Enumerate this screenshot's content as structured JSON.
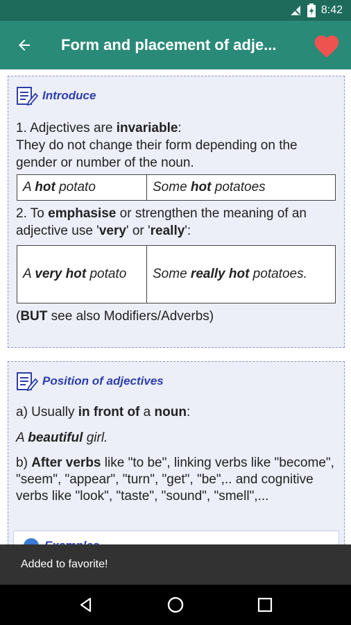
{
  "status_bar": {
    "time": "8:42"
  },
  "app_bar": {
    "title": "Form and placement of adje..."
  },
  "card_introduce": {
    "title": "Introduce",
    "p1_a": "1. Adjectives are ",
    "p1_b": "invariable",
    "p1_c": ":",
    "p1_d": "They do not change their form depending on the gender or number of the noun.",
    "table1": [
      {
        "pre": "A ",
        "bold": "hot",
        "post": " potato"
      },
      {
        "pre": "Some ",
        "bold": "hot",
        "post": " potatoes"
      }
    ],
    "p2_a": "2. To ",
    "p2_b": "emphasise",
    "p2_c": " or strengthen the meaning of an adjective use '",
    "p2_d": "very",
    "p2_e": "' or '",
    "p2_f": "really",
    "p2_g": "':",
    "table2": [
      {
        "pre": "A ",
        "bold": "very hot",
        "post": " potato"
      },
      {
        "pre": "Some ",
        "bold": "really hot",
        "post": " potatoes."
      }
    ],
    "p3_a": "(",
    "p3_b": "BUT",
    "p3_c": " see also Modifiers/Adverbs)"
  },
  "card_position": {
    "title": "Position of adjectives",
    "a_1": "a) Usually ",
    "a_2": "in front of",
    "a_3": " a ",
    "a_4": "noun",
    "a_5": ":",
    "ex_1": "A ",
    "ex_2": "beautiful",
    "ex_3": " girl.",
    "b_1": "b) ",
    "b_2": "After verbs",
    "b_3": " like \"to be\", linking verbs like \"become\", \"seem\", \"appear\", \"turn\", \"get\", \"be\",.. and  cognitive verbs like  \"look\", \"taste\", \"sound\", \"smell\",..."
  },
  "examples_peek": {
    "label": "Examples"
  },
  "snackbar": {
    "message": "Added to favorite!"
  },
  "colors": {
    "toolbar": "#2a8a78",
    "statusbar": "#1e6b5c",
    "accent": "#2d3eaa",
    "heart": "#ef5350"
  }
}
